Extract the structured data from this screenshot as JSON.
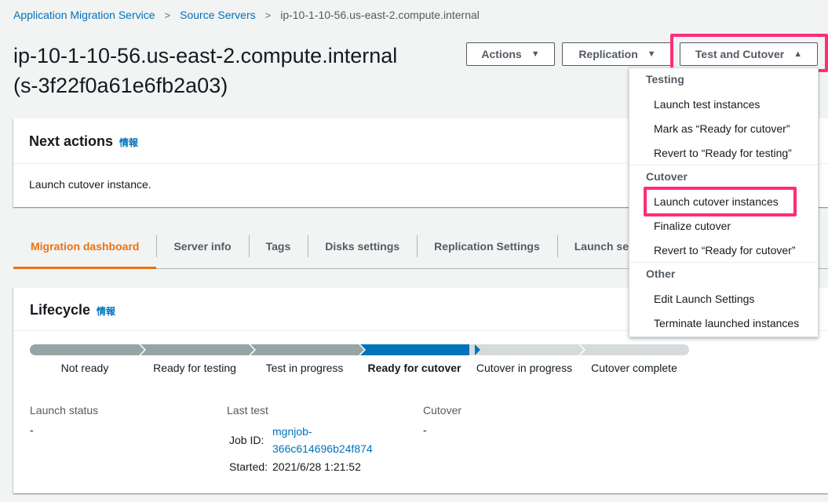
{
  "breadcrumb": {
    "items": [
      "Application Migration Service",
      "Source Servers",
      "ip-10-1-10-56.us-east-2.compute.internal"
    ]
  },
  "title": {
    "line1": "ip-10-1-10-56.us-east-2.compute.internal",
    "line2": "(s-3f22f0a61e6fb2a03)"
  },
  "buttons": {
    "actions": "Actions",
    "replication": "Replication",
    "test_cutover": "Test and Cutover",
    "caret_down": "▼",
    "caret_up": "▲"
  },
  "next_actions": {
    "title": "Next actions",
    "info": "情報",
    "body": "Launch cutover instance."
  },
  "tabs": [
    "Migration dashboard",
    "Server info",
    "Tags",
    "Disks settings",
    "Replication Settings",
    "Launch settings"
  ],
  "lifecycle": {
    "title": "Lifecycle",
    "info": "情報",
    "steps": [
      {
        "label": "Not ready",
        "state": "done"
      },
      {
        "label": "Ready for testing",
        "state": "done"
      },
      {
        "label": "Test in progress",
        "state": "done"
      },
      {
        "label": "Ready for cutover",
        "state": "current"
      },
      {
        "label": "Cutover in progress",
        "state": "pending"
      },
      {
        "label": "Cutover complete",
        "state": "pending"
      }
    ],
    "launch_status_label": "Launch status",
    "launch_status_value": "-",
    "last_test_label": "Last test",
    "job_id_label": "Job ID:",
    "job_id_value_1": "mgnjob-",
    "job_id_value_2": "366c614696b24f874",
    "started_label": "Started:",
    "started_value": "2021/6/28 1:21:52",
    "cutover_label": "Cutover",
    "cutover_value": "-"
  },
  "dropdown": {
    "groups": [
      {
        "header": "Testing",
        "items": [
          "Launch test instances",
          "Mark as “Ready for cutover”",
          "Revert to “Ready for testing”"
        ]
      },
      {
        "header": "Cutover",
        "items": [
          "Launch cutover instances",
          "Finalize cutover",
          "Revert to “Ready for cutover”"
        ]
      },
      {
        "header": "Other",
        "items": [
          "Edit Launch Settings",
          "Terminate launched instances"
        ]
      }
    ]
  },
  "colors": {
    "done": "#95a5a6",
    "current": "#0073bb",
    "pending": "#d5dbdb",
    "highlight": "#ff2d78",
    "active_tab": "#ec7211"
  }
}
